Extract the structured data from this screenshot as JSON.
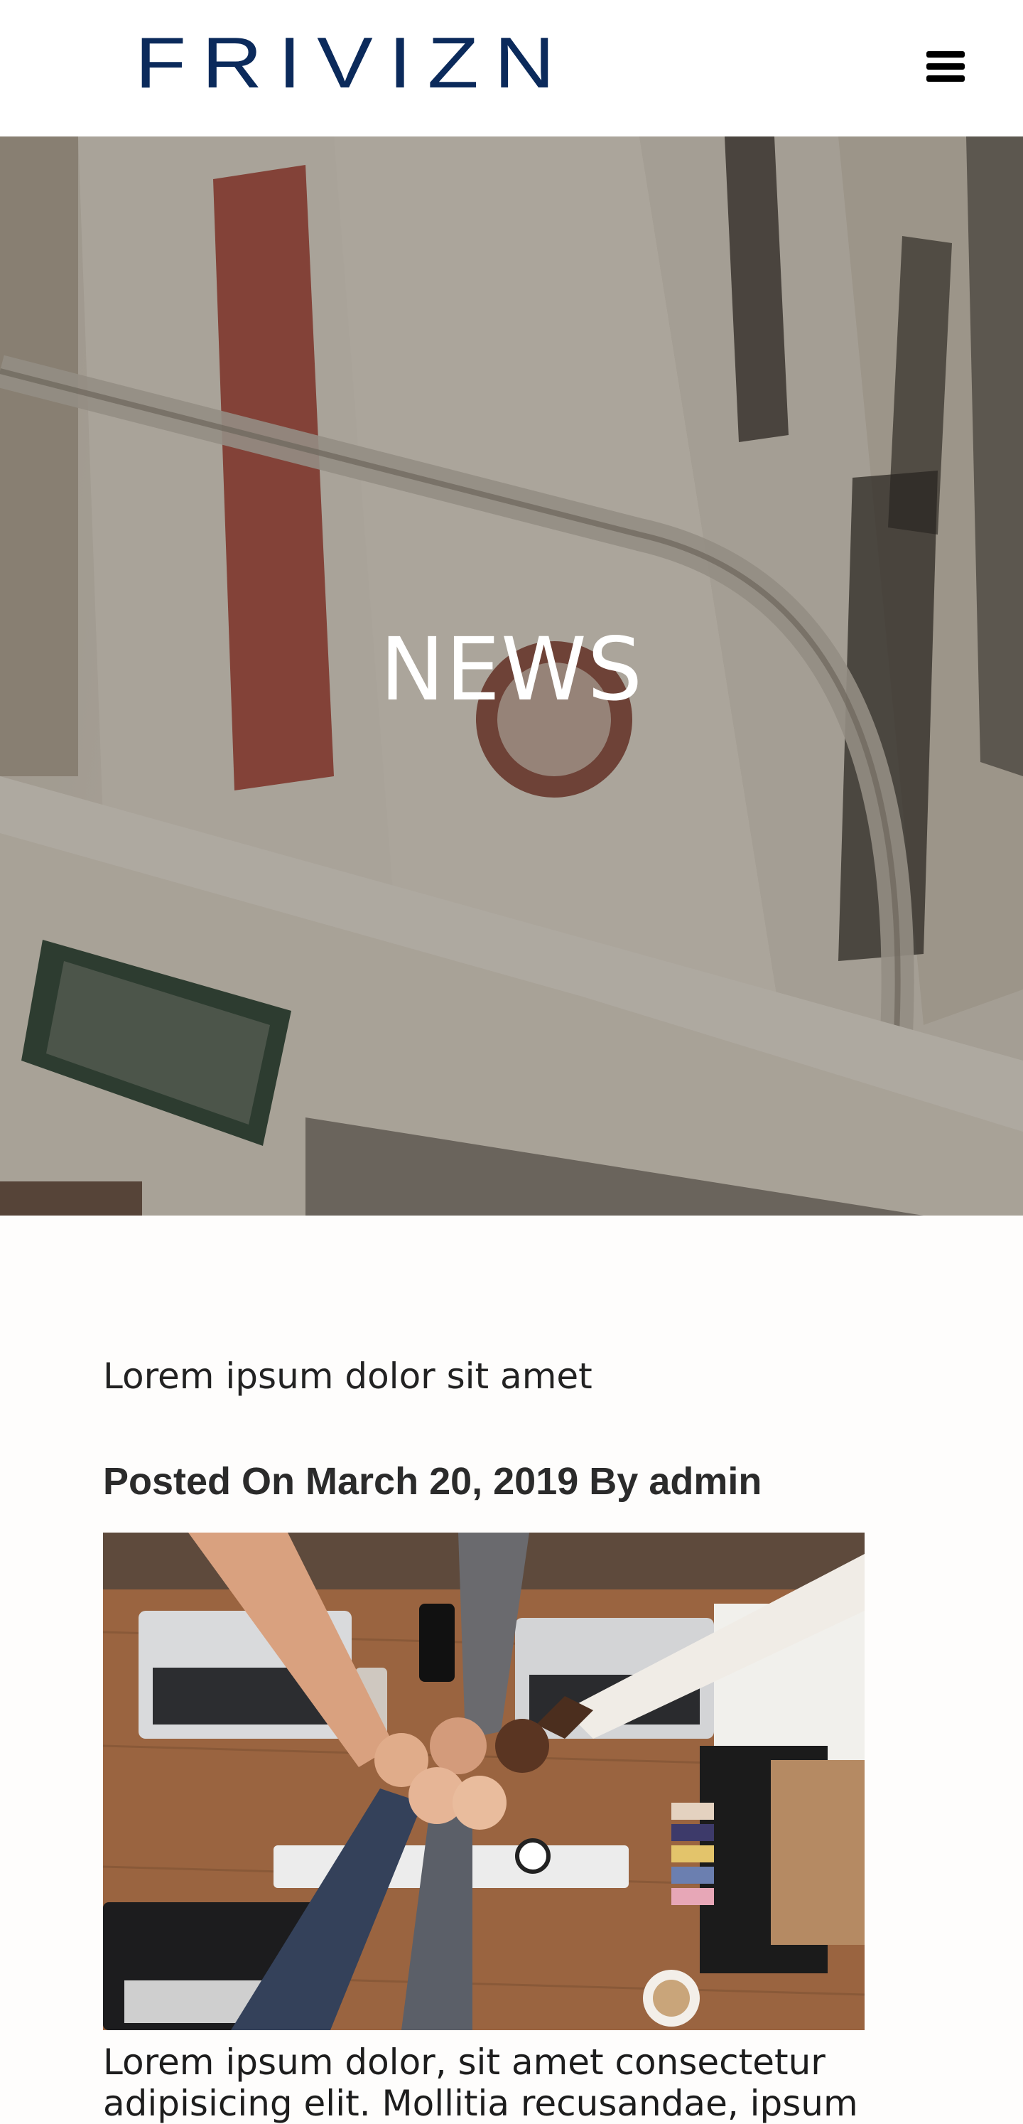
{
  "header": {
    "logo_text": "FRIVIZN",
    "menu_icon": "hamburger-menu-icon",
    "logo_color": "#0b2a5b"
  },
  "hero": {
    "title": "NEWS"
  },
  "post": {
    "title": "Lorem ipsum dolor sit amet",
    "meta": "Posted On March 20, 2019 By admin",
    "excerpt": "Lorem ipsum dolor, sit amet consectetur adipisicing elit. Mollitia recusandae, ipsum"
  }
}
